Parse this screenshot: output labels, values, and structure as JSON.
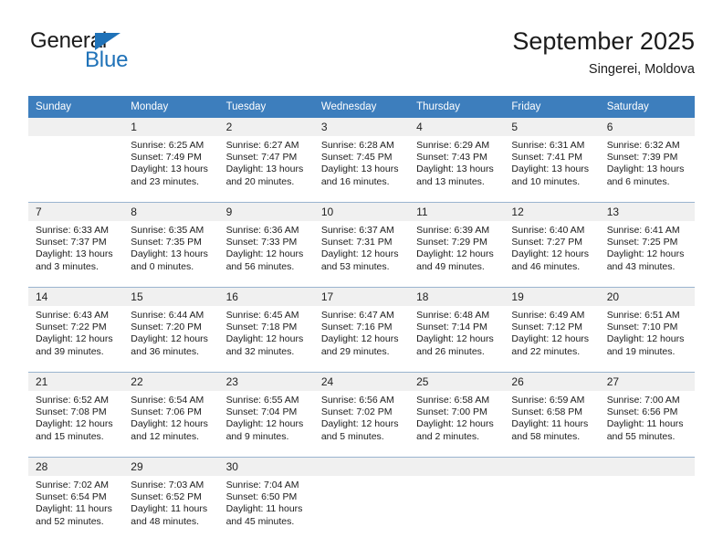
{
  "brand": {
    "name_top": "General",
    "name_bottom": "Blue",
    "accent_color": "#1f72b8",
    "triangle_icon": "triangle-icon"
  },
  "header": {
    "title": "September 2025",
    "subtitle": "Singerei, Moldova"
  },
  "colors": {
    "header_blue": "#3d7ebd",
    "daynum_band": "#f0f0f0",
    "row_divider": "#9ab4cf",
    "text": "#1b1b1b"
  },
  "weekday_headers": [
    "Sunday",
    "Monday",
    "Tuesday",
    "Wednesday",
    "Thursday",
    "Friday",
    "Saturday"
  ],
  "weeks": [
    [
      {
        "day": "",
        "lines": []
      },
      {
        "day": "1",
        "lines": [
          "Sunrise: 6:25 AM",
          "Sunset: 7:49 PM",
          "Daylight: 13 hours",
          "and 23 minutes."
        ]
      },
      {
        "day": "2",
        "lines": [
          "Sunrise: 6:27 AM",
          "Sunset: 7:47 PM",
          "Daylight: 13 hours",
          "and 20 minutes."
        ]
      },
      {
        "day": "3",
        "lines": [
          "Sunrise: 6:28 AM",
          "Sunset: 7:45 PM",
          "Daylight: 13 hours",
          "and 16 minutes."
        ]
      },
      {
        "day": "4",
        "lines": [
          "Sunrise: 6:29 AM",
          "Sunset: 7:43 PM",
          "Daylight: 13 hours",
          "and 13 minutes."
        ]
      },
      {
        "day": "5",
        "lines": [
          "Sunrise: 6:31 AM",
          "Sunset: 7:41 PM",
          "Daylight: 13 hours",
          "and 10 minutes."
        ]
      },
      {
        "day": "6",
        "lines": [
          "Sunrise: 6:32 AM",
          "Sunset: 7:39 PM",
          "Daylight: 13 hours",
          "and 6 minutes."
        ]
      }
    ],
    [
      {
        "day": "7",
        "lines": [
          "Sunrise: 6:33 AM",
          "Sunset: 7:37 PM",
          "Daylight: 13 hours",
          "and 3 minutes."
        ]
      },
      {
        "day": "8",
        "lines": [
          "Sunrise: 6:35 AM",
          "Sunset: 7:35 PM",
          "Daylight: 13 hours",
          "and 0 minutes."
        ]
      },
      {
        "day": "9",
        "lines": [
          "Sunrise: 6:36 AM",
          "Sunset: 7:33 PM",
          "Daylight: 12 hours",
          "and 56 minutes."
        ]
      },
      {
        "day": "10",
        "lines": [
          "Sunrise: 6:37 AM",
          "Sunset: 7:31 PM",
          "Daylight: 12 hours",
          "and 53 minutes."
        ]
      },
      {
        "day": "11",
        "lines": [
          "Sunrise: 6:39 AM",
          "Sunset: 7:29 PM",
          "Daylight: 12 hours",
          "and 49 minutes."
        ]
      },
      {
        "day": "12",
        "lines": [
          "Sunrise: 6:40 AM",
          "Sunset: 7:27 PM",
          "Daylight: 12 hours",
          "and 46 minutes."
        ]
      },
      {
        "day": "13",
        "lines": [
          "Sunrise: 6:41 AM",
          "Sunset: 7:25 PM",
          "Daylight: 12 hours",
          "and 43 minutes."
        ]
      }
    ],
    [
      {
        "day": "14",
        "lines": [
          "Sunrise: 6:43 AM",
          "Sunset: 7:22 PM",
          "Daylight: 12 hours",
          "and 39 minutes."
        ]
      },
      {
        "day": "15",
        "lines": [
          "Sunrise: 6:44 AM",
          "Sunset: 7:20 PM",
          "Daylight: 12 hours",
          "and 36 minutes."
        ]
      },
      {
        "day": "16",
        "lines": [
          "Sunrise: 6:45 AM",
          "Sunset: 7:18 PM",
          "Daylight: 12 hours",
          "and 32 minutes."
        ]
      },
      {
        "day": "17",
        "lines": [
          "Sunrise: 6:47 AM",
          "Sunset: 7:16 PM",
          "Daylight: 12 hours",
          "and 29 minutes."
        ]
      },
      {
        "day": "18",
        "lines": [
          "Sunrise: 6:48 AM",
          "Sunset: 7:14 PM",
          "Daylight: 12 hours",
          "and 26 minutes."
        ]
      },
      {
        "day": "19",
        "lines": [
          "Sunrise: 6:49 AM",
          "Sunset: 7:12 PM",
          "Daylight: 12 hours",
          "and 22 minutes."
        ]
      },
      {
        "day": "20",
        "lines": [
          "Sunrise: 6:51 AM",
          "Sunset: 7:10 PM",
          "Daylight: 12 hours",
          "and 19 minutes."
        ]
      }
    ],
    [
      {
        "day": "21",
        "lines": [
          "Sunrise: 6:52 AM",
          "Sunset: 7:08 PM",
          "Daylight: 12 hours",
          "and 15 minutes."
        ]
      },
      {
        "day": "22",
        "lines": [
          "Sunrise: 6:54 AM",
          "Sunset: 7:06 PM",
          "Daylight: 12 hours",
          "and 12 minutes."
        ]
      },
      {
        "day": "23",
        "lines": [
          "Sunrise: 6:55 AM",
          "Sunset: 7:04 PM",
          "Daylight: 12 hours",
          "and 9 minutes."
        ]
      },
      {
        "day": "24",
        "lines": [
          "Sunrise: 6:56 AM",
          "Sunset: 7:02 PM",
          "Daylight: 12 hours",
          "and 5 minutes."
        ]
      },
      {
        "day": "25",
        "lines": [
          "Sunrise: 6:58 AM",
          "Sunset: 7:00 PM",
          "Daylight: 12 hours",
          "and 2 minutes."
        ]
      },
      {
        "day": "26",
        "lines": [
          "Sunrise: 6:59 AM",
          "Sunset: 6:58 PM",
          "Daylight: 11 hours",
          "and 58 minutes."
        ]
      },
      {
        "day": "27",
        "lines": [
          "Sunrise: 7:00 AM",
          "Sunset: 6:56 PM",
          "Daylight: 11 hours",
          "and 55 minutes."
        ]
      }
    ],
    [
      {
        "day": "28",
        "lines": [
          "Sunrise: 7:02 AM",
          "Sunset: 6:54 PM",
          "Daylight: 11 hours",
          "and 52 minutes."
        ]
      },
      {
        "day": "29",
        "lines": [
          "Sunrise: 7:03 AM",
          "Sunset: 6:52 PM",
          "Daylight: 11 hours",
          "and 48 minutes."
        ]
      },
      {
        "day": "30",
        "lines": [
          "Sunrise: 7:04 AM",
          "Sunset: 6:50 PM",
          "Daylight: 11 hours",
          "and 45 minutes."
        ]
      },
      {
        "day": "",
        "lines": []
      },
      {
        "day": "",
        "lines": []
      },
      {
        "day": "",
        "lines": []
      },
      {
        "day": "",
        "lines": []
      }
    ]
  ]
}
